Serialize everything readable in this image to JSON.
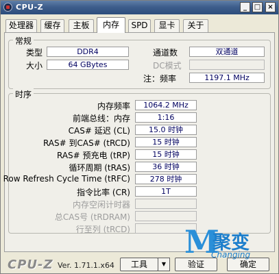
{
  "window": {
    "title": "CPU-Z",
    "min_glyph": "_",
    "max_glyph": "□",
    "close_glyph": "×"
  },
  "tabs": [
    {
      "label": "处理器"
    },
    {
      "label": "缓存"
    },
    {
      "label": "主板"
    },
    {
      "label": "内存"
    },
    {
      "label": "SPD"
    },
    {
      "label": "显卡"
    },
    {
      "label": "关于"
    }
  ],
  "active_tab": "内存",
  "general": {
    "title": "常规",
    "type_label": "类型",
    "type_value": "DDR4",
    "size_label": "大小",
    "size_value": "64 GBytes",
    "channels_label": "通道数",
    "channels_value": "双通道",
    "dc_mode_label": "DC模式",
    "dc_mode_value": "",
    "note_label": "注：频率",
    "note_value": "1197.1 MHz"
  },
  "timings": {
    "title": "时序",
    "rows": [
      {
        "label": "内存频率",
        "value": "1064.2 MHz",
        "enabled": true
      },
      {
        "label": "前端总线：内存",
        "value": "1:16",
        "enabled": true
      },
      {
        "label": "CAS# 延迟 (CL)",
        "value": "15.0 时钟",
        "enabled": true
      },
      {
        "label": "RAS# 到CAS# (tRCD)",
        "value": "15 时钟",
        "enabled": true
      },
      {
        "label": "RAS# 预充电 (tRP)",
        "value": "15 时钟",
        "enabled": true
      },
      {
        "label": "循环周期 (tRAS)",
        "value": "36 时钟",
        "enabled": true
      },
      {
        "label": "Row Refresh Cycle Time (tRFC)",
        "value": "278 时钟",
        "enabled": true
      },
      {
        "label": "指令比率 (CR)",
        "value": "1T",
        "enabled": true
      },
      {
        "label": "内存空闲计时器",
        "value": "",
        "enabled": false
      },
      {
        "label": "总CAS号 (tRDRAM)",
        "value": "",
        "enabled": false
      },
      {
        "label": "行至列 (tRCD)",
        "value": "",
        "enabled": false
      }
    ]
  },
  "footer": {
    "logo": "CPU-Z",
    "version": "Ver. 1.71.1.x64",
    "tools_label": "工具",
    "tools_arrow": "▼",
    "validate_label": "验证",
    "ok_label": "确定"
  },
  "watermark": {
    "m": "M",
    "chars": "聚变",
    "changing": "Changing"
  },
  "colors": {
    "title_bar": "#3e5e8c",
    "value_text": "#000060",
    "disabled_label": "#9d9d9d",
    "watermark": "#1e7fcc"
  }
}
